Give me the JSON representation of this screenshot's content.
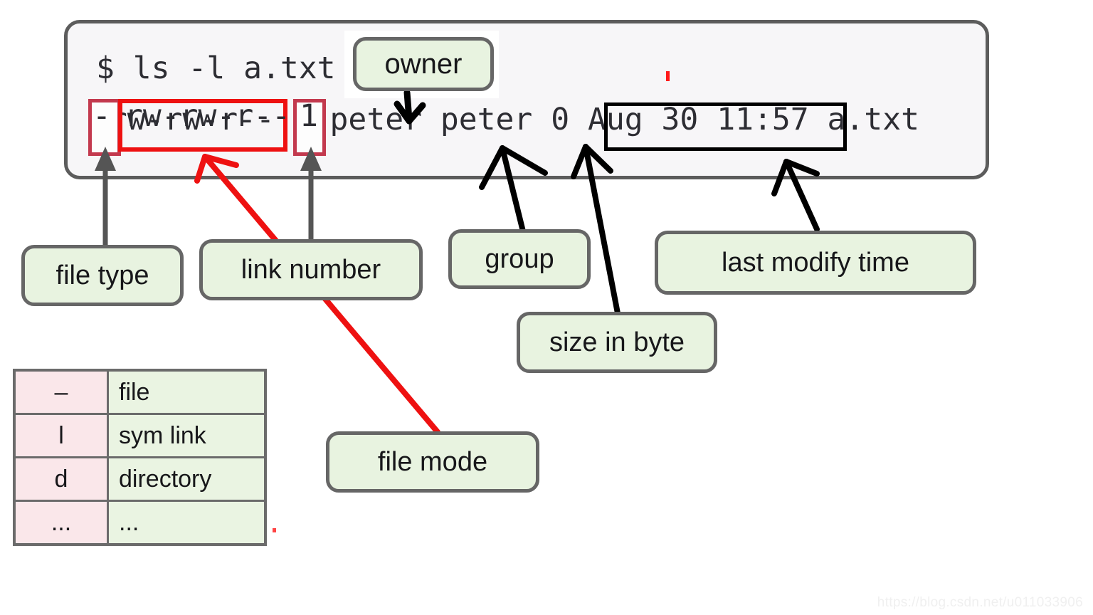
{
  "terminal": {
    "prompt_line": "$ ls -l a.txt",
    "listing_line": "-rw-rw-r-- 1 peter peter 0 Aug 30 11:57 a.txt",
    "fields": {
      "file_type": "-",
      "file_mode": "rw-rw-r--",
      "link_number": "1",
      "owner": "peter",
      "group": "peter",
      "size": "0",
      "mtime": "Aug 30 11:57",
      "filename": "a.txt"
    },
    "background": "#f7f6f8",
    "border_color": "#5c5c5c",
    "text_color": "#2d2d33"
  },
  "callouts": [
    {
      "id": "owner",
      "label": "owner"
    },
    {
      "id": "file-type",
      "label": "file type"
    },
    {
      "id": "link-number",
      "label": "link number"
    },
    {
      "id": "group",
      "label": "group"
    },
    {
      "id": "mtime",
      "label": "last modify time"
    },
    {
      "id": "size",
      "label": "size in byte"
    },
    {
      "id": "file-mode",
      "label": "file mode"
    }
  ],
  "highlight_boxes": [
    {
      "id": "file-type",
      "target": "-",
      "color": "#c3394e"
    },
    {
      "id": "file-mode",
      "target": "rw-rw-r--",
      "color": "#ee1111"
    },
    {
      "id": "link-number",
      "target": "1",
      "color": "#c3394e"
    },
    {
      "id": "mtime",
      "target": "Aug 30 11:57",
      "color": "#000000"
    }
  ],
  "file_type_table": {
    "rows": [
      {
        "code": "–",
        "desc": "file"
      },
      {
        "code": "l",
        "desc": "sym link"
      },
      {
        "code": "d",
        "desc": "directory"
      },
      {
        "code": "...",
        "desc": "..."
      }
    ],
    "code_cell_color": "#fae7ea",
    "desc_cell_color": "#eaf4e2",
    "border_color": "#6b6b6b"
  },
  "colors": {
    "callout_fill": "#e8f3e0",
    "callout_border": "#666666",
    "accent_red": "#ee1111",
    "muted_red": "#c3394e",
    "arrow_gray": "#555555",
    "arrow_black": "#000000"
  },
  "watermark": "https://blog.csdn.net/u011033906"
}
